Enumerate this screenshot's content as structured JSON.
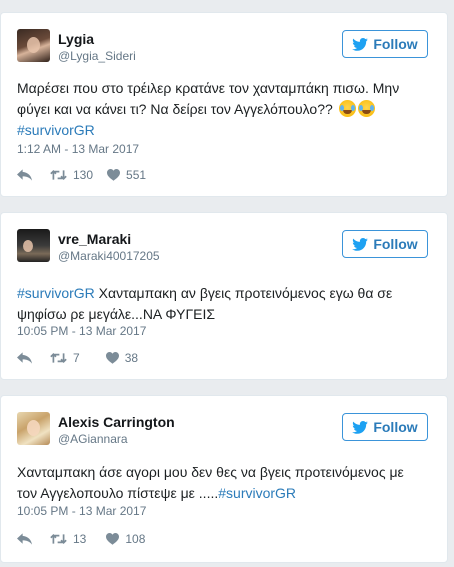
{
  "follow_label": "Follow",
  "colors": {
    "link": "#2b7bb9",
    "muted": "#657786",
    "border": "#e1e8ed"
  },
  "tweets": [
    {
      "name": "Lygia",
      "handle": "@Lygia_Sideri",
      "text_line1": "Μαρέσει που στο τρέιλερ κρατάνε τον χανταμπάκη πισω. Μην",
      "text_line2": "φύγει και να κάνει τι? Να δείρει τον Αγγελόπουλο??",
      "emoji": "face-with-tears-of-joy x2",
      "hashtag": "#survivorGR",
      "timestamp": "1:12 AM - 13 Mar 2017",
      "retweets": "130",
      "likes": "551"
    },
    {
      "name": "vre_Maraki",
      "handle": "@Maraki40017205",
      "hashtag": "#survivorGR",
      "text_line1_rest": " Χανταμπακη αν βγεις προτεινόμενος εγω θα σε",
      "text_line2": "ψηφίσω ρε μεγάλε...ΝΑ ΦΥΓΕΙΣ",
      "timestamp": "10:05 PM - 13 Mar 2017",
      "retweets": "7",
      "likes": "38"
    },
    {
      "name": "Alexis Carrington",
      "handle": "@AGiannara",
      "text_line1": "Χανταμπακη άσε αγορι μου δεν θες να βγεις προτεινόμενος με",
      "text_line2_pre": "τον Αγγελοπουλο πίστεψε με .....",
      "hashtag": "#survivorGR",
      "timestamp": "10:05 PM - 13 Mar 2017",
      "retweets": "13",
      "likes": "108"
    }
  ]
}
